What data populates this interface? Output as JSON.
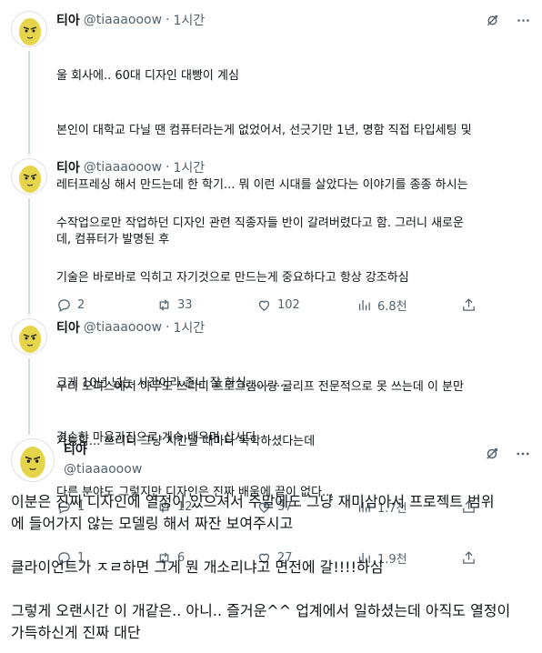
{
  "author": {
    "name": "티아",
    "handle": "@tiaaaooow",
    "separator": "·"
  },
  "replies": [
    {
      "time": "1시간",
      "lines": [
        "울 회사에.. 60대 디자인 대빵이 계심",
        "본인이 대학교 다닐 땐 컴퓨터라는게 없었어서, 선긋기만 1년, 명함 직접 타입세팅 및",
        "레터프레싱 해서 만드는데 한 학기... 뭐 이런 시대를 살았다는 이야기를 종종 하시는",
        "데, 컴퓨터가 발명된 후"
      ],
      "stats": {
        "replies": "2",
        "reposts": "33",
        "likes": "102",
        "views": "6.8천"
      }
    },
    {
      "time": "1시간",
      "lines": [
        "수작업으로만 작업하던 디자인 관련 직종자들 반이 갈려버렸다고 함. 그러니 새로운",
        "기술은 바로바로 익히고 자기것으로 만드는게 중요하다고 항상 강조하심",
        "",
        "우리 오피스에서 아무도 쓰리디 프로그램이랑 글리프 전문적으로 못 쓰는데 이 분만",
        "가능함... 쓰리디 그냥 시간날 때마다 독학하셨다는데"
      ],
      "stats": {
        "replies": "1",
        "reposts": "12",
        "likes": "37",
        "views": "1.7천"
      }
    },
    {
      "time": "1시간",
      "lines": [
        "그게 10년 넘는 시간이라 존나 잘 하심...........",
        "겸손한 마음가짐으로 계속 배우며 삽시다",
        "다른 분야도 그렇지만 디자인은 진짜 배움에 끝이 없다..."
      ],
      "stats": {
        "replies": "1",
        "reposts": "6",
        "likes": "27",
        "views": "1.9천"
      }
    }
  ],
  "main_tweet": {
    "lines": [
      "이분은 진짜 디자인에 열정이 있으셔서 주말에도 그냥 재미삼아서 프로젝트 범위",
      "에 들어가지 않는 모델링 해서 짜잔 보여주시고",
      "",
      "클라이언트가 ㅈㄹ하면 그게 뭔 개소리냐고 면전에 갈!!!!하심",
      "",
      "그렇게 오랜시간 이 개같은.. 아니.. 즐거운^^ 업계에서 일하셨는데 아직도 열정이",
      "가득하신게 진짜 대단"
    ]
  },
  "icons": {
    "grok": "grok-icon",
    "more": "more-icon",
    "reply": "reply-icon",
    "repost": "repost-icon",
    "like": "like-icon",
    "views": "views-icon",
    "share": "share-icon"
  },
  "colors": {
    "text": "#0f1419",
    "secondary": "#536471",
    "thread_line": "#cfd9de",
    "avatar_face": "#e6d54a"
  }
}
